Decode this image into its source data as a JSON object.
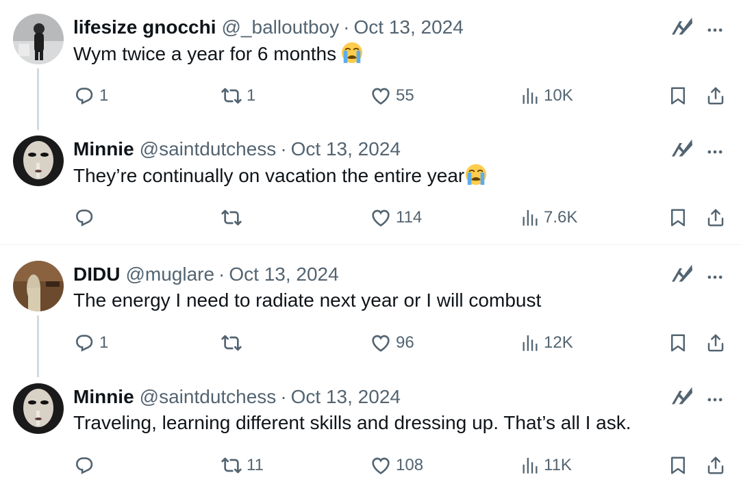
{
  "tweets": [
    {
      "name": "lifesize gnocchi",
      "handle": "@_balloutboy",
      "separator": "·",
      "date": "Oct 13, 2024",
      "text": "Wym twice a year for 6 months",
      "emoji": "loudly-crying-face",
      "replies": "1",
      "reposts": "1",
      "likes": "55",
      "views": "10K"
    },
    {
      "name": "Minnie",
      "handle": "@saintdutchess",
      "separator": "·",
      "date": "Oct 13, 2024",
      "text": "They’re continually on vacation the entire year",
      "emoji": "loudly-crying-face",
      "replies": "",
      "reposts": "",
      "likes": "114",
      "views": "7.6K"
    },
    {
      "name": "DIDU",
      "handle": "@muglare",
      "separator": "·",
      "date": "Oct 13, 2024",
      "text": "The energy I need to radiate next year or I will combust",
      "replies": "1",
      "reposts": "",
      "likes": "96",
      "views": "12K"
    },
    {
      "name": "Minnie",
      "handle": "@saintdutchess",
      "separator": "·",
      "date": "Oct 13, 2024",
      "text": "Traveling, learning different skills and dressing up. That’s all I ask.",
      "replies": "",
      "reposts": "11",
      "likes": "108",
      "views": "11K"
    }
  ],
  "icons": [
    "grok-icon",
    "more-icon",
    "reply-icon",
    "retweet-icon",
    "like-icon",
    "views-icon",
    "bookmark-icon",
    "share-icon"
  ],
  "colors": {
    "text": "#0f1419",
    "secondary": "#536471",
    "thread_line": "#cfd9de",
    "divider": "#eff3f4"
  }
}
